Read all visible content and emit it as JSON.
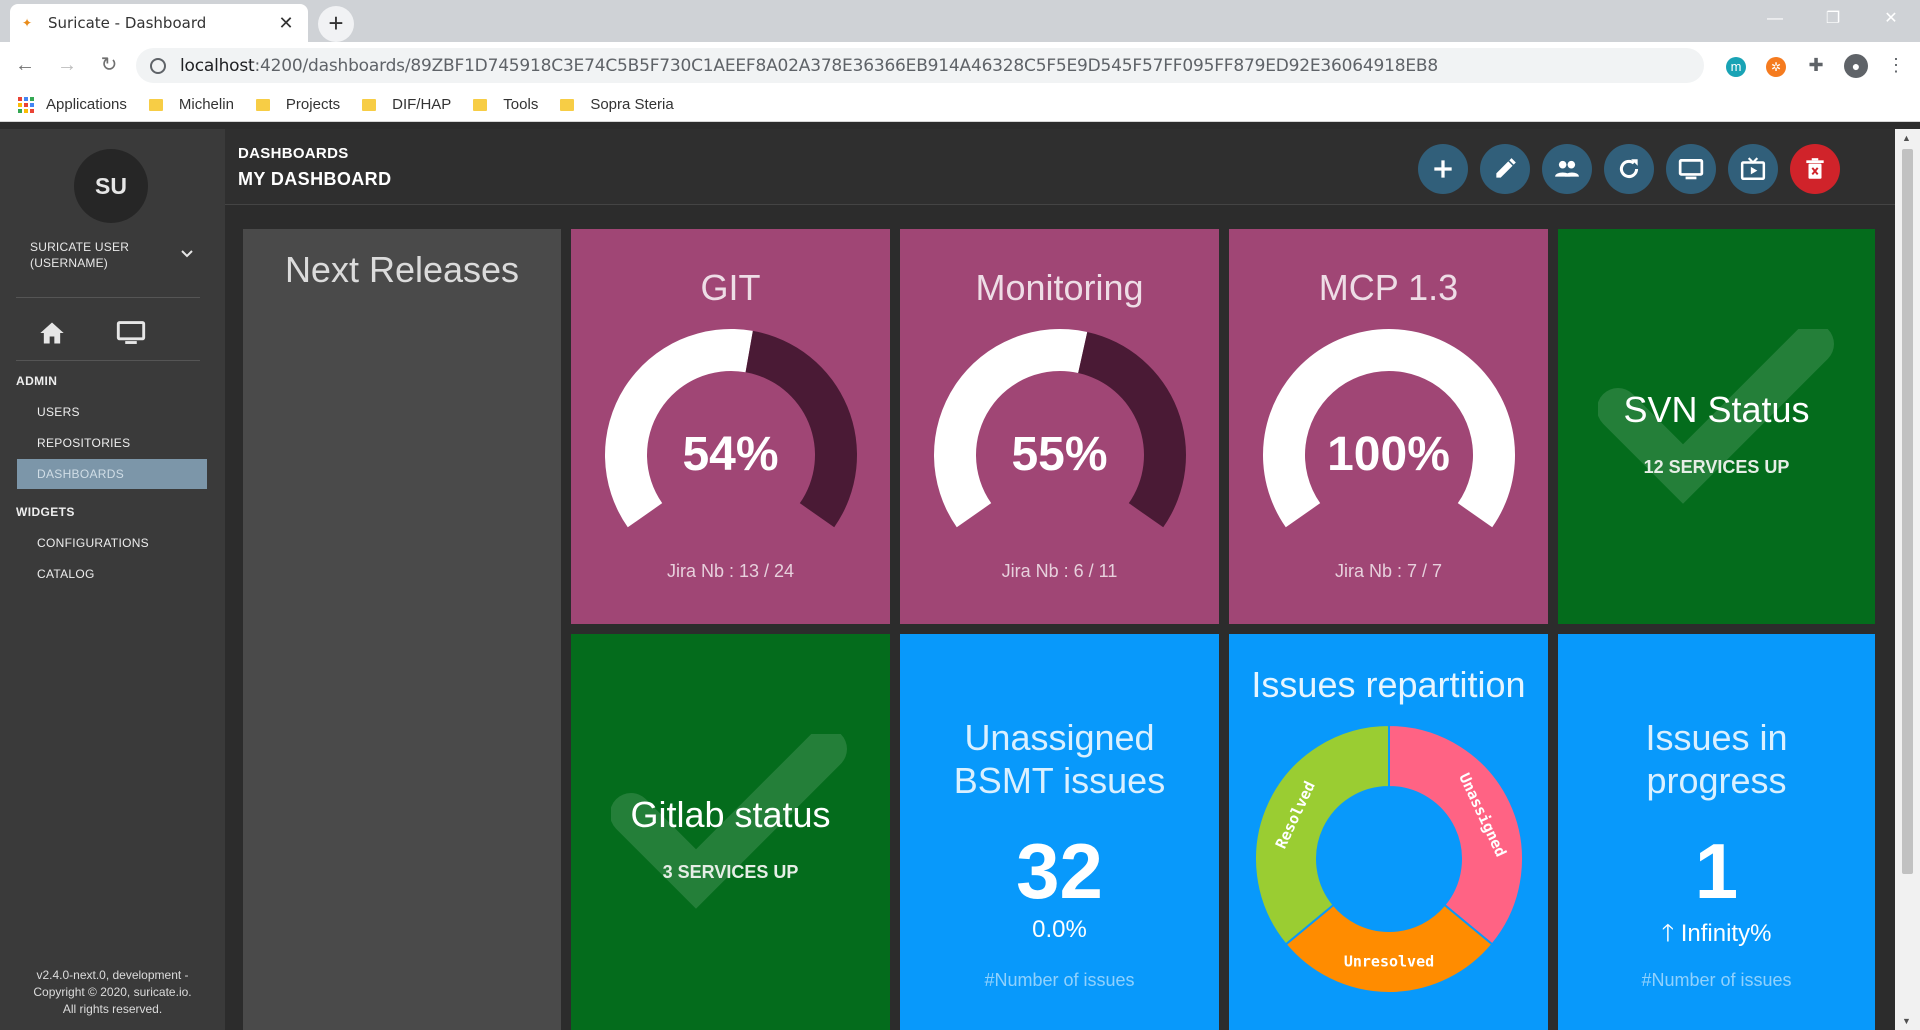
{
  "browser": {
    "tab_title": "Suricate - Dashboard",
    "tab_close": "✕",
    "new_tab": "+",
    "url_host": "localhost",
    "url_path": ":4200/dashboards/89ZBF1D745918C3E74C5B5F730C1AEEF8A02A378E36366EB914A46328C5F5E9D545F57FF095FF879ED92E36064918EB8",
    "bookmarks": [
      "Applications",
      "Michelin",
      "Projects",
      "DIF/HAP",
      "Tools",
      "Sopra Steria"
    ],
    "ext_m": "m",
    "ext_o": "✲",
    "ext_puzzle": "✚",
    "ext_user": "●",
    "menu": "⋮"
  },
  "sidebar": {
    "avatar_initials": "SU",
    "user_line1": "SURICATE USER",
    "user_line2": "(USERNAME)",
    "admin_label": "ADMIN",
    "admin_items": [
      "USERS",
      "REPOSITORIES",
      "DASHBOARDS"
    ],
    "active_item": "DASHBOARDS",
    "widgets_label": "WIDGETS",
    "widget_items": [
      "CONFIGURATIONS",
      "CATALOG"
    ],
    "version_line1": "v2.4.0-next.0, development -",
    "version_line2": "Copyright © 2020, suricate.io.",
    "version_line3": "All rights reserved."
  },
  "header": {
    "crumb_top": "DASHBOARDS",
    "crumb_bottom": "MY DASHBOARD",
    "buttons": [
      "add-widget",
      "edit",
      "share",
      "refresh",
      "display-screen",
      "tv-mode",
      "delete"
    ]
  },
  "widgets": {
    "releases_title": "Next Releases",
    "gauges": [
      {
        "title": "GIT",
        "value": "54%",
        "fraction": 0.54,
        "sub": "Jira Nb : 13 / 24"
      },
      {
        "title": "Monitoring",
        "value": "55%",
        "fraction": 0.55,
        "sub": "Jira Nb : 6 / 11"
      },
      {
        "title": "MCP 1.3",
        "value": "100%",
        "fraction": 1.0,
        "sub": "Jira Nb : 7 / 7"
      }
    ],
    "svn": {
      "title": "SVN Status",
      "sub": "12 SERVICES UP"
    },
    "gitlab": {
      "title": "Gitlab status",
      "sub": "3 SERVICES UP"
    },
    "unassigned": {
      "title_l1": "Unassigned",
      "title_l2": "BSMT issues",
      "value": "32",
      "delta": "0.0%",
      "foot": "#Number of issues"
    },
    "repartition": {
      "title": "Issues repartition",
      "slices": [
        {
          "label": "Unassigned",
          "share": 0.36,
          "color": "#ff6384"
        },
        {
          "label": "Unresolved",
          "share": 0.28,
          "color": "#ff8c00"
        },
        {
          "label": "Resolved",
          "share": 0.36,
          "color": "#9acd32"
        }
      ]
    },
    "inprogress": {
      "title_l1": "Issues in",
      "title_l2": "progress",
      "value": "1",
      "delta": "Infinity%",
      "foot": "#Number of issues"
    }
  },
  "colors": {
    "purple_tile": "#a04675",
    "green_tile": "#046c1c",
    "blue_tile": "#0899fb",
    "releases_tile": "#4a4a4a",
    "gauge_track": "#4a1a35",
    "header_button": "#315f7a",
    "delete_button": "#d0232a"
  }
}
